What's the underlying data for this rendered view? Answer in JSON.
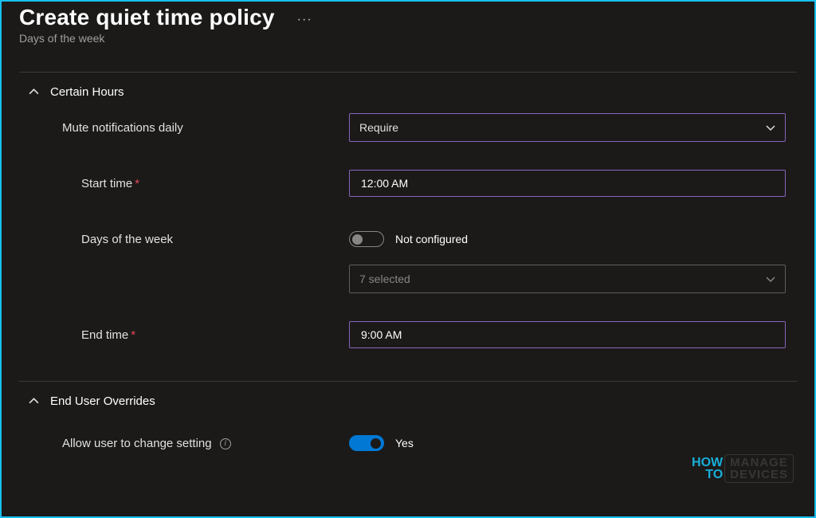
{
  "header": {
    "title": "Create quiet time policy",
    "subtitle": "Days of the week",
    "more": "···"
  },
  "section_hours": {
    "title": "Certain Hours",
    "mute_label": "Mute notifications daily",
    "mute_value": "Require",
    "start_label": "Start time",
    "start_value": "12:00 AM",
    "days_label": "Days of the week",
    "days_toggle_text": "Not configured",
    "days_select_value": "7 selected",
    "end_label": "End time",
    "end_value": "9:00 AM"
  },
  "section_overrides": {
    "title": "End User Overrides",
    "allow_label": "Allow user to change setting",
    "allow_value": "Yes"
  },
  "watermark": {
    "line1": "HOW",
    "line2": "TO",
    "right1": "MANAGE",
    "right2": "DEVICES"
  }
}
